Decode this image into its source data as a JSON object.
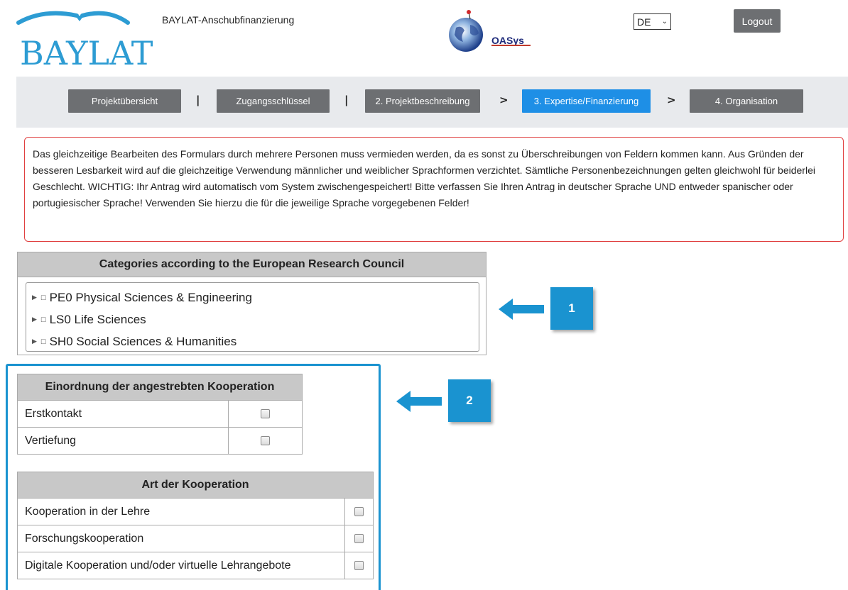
{
  "header": {
    "logo_text": "BAYLAT",
    "app_title": "BAYLAT-Anschubfinanzierung",
    "partner_logo_text": "OASys",
    "language": {
      "selected": "DE"
    },
    "logout_label": "Logout"
  },
  "nav": {
    "items": [
      {
        "label": "Projektübersicht",
        "active": false
      },
      {
        "label": "Zugangsschlüssel",
        "active": false
      },
      {
        "label": "2. Projektbeschreibung",
        "active": false
      },
      {
        "label": "3. Expertise/Finanzierung",
        "active": true
      },
      {
        "label": "4. Organisation",
        "active": false
      }
    ],
    "separators": [
      "|",
      "|",
      ">",
      ">"
    ]
  },
  "notice": {
    "text": "Das gleichzeitige Bearbeiten des Formulars durch mehrere Personen muss vermieden werden, da es sonst zu Überschreibungen von Feldern kommen kann. Aus Gründen der besseren Lesbarkeit wird auf die gleichzeitige Verwendung männlicher und weiblicher Sprachformen verzichtet. Sämtliche Personenbezeichnungen gelten gleichwohl für beiderlei Geschlecht. WICHTIG: Ihr Antrag wird automatisch vom System zwischengespeichert! Bitte verfassen Sie Ihren Antrag in deutscher Sprache UND entweder spanischer oder portugiesischer Sprache! Verwenden Sie hierzu die für die jeweilige Sprache vorgegebenen Felder!"
  },
  "erc": {
    "title": "Categories according to the European Research Council",
    "items": [
      {
        "label": "PE0 Physical Sciences & Engineering"
      },
      {
        "label": "LS0 Life Sciences"
      },
      {
        "label": "SH0 Social Sciences & Humanities"
      }
    ]
  },
  "cooperation_class": {
    "title": "Einordnung der angestrebten Kooperation",
    "rows": [
      {
        "label": "Erstkontakt",
        "checked": false
      },
      {
        "label": "Vertiefung",
        "checked": false
      }
    ]
  },
  "cooperation_type": {
    "title": "Art der Kooperation",
    "rows": [
      {
        "label": "Kooperation in der Lehre",
        "checked": false
      },
      {
        "label": "Forschungskooperation",
        "checked": false
      },
      {
        "label": "Digitale Kooperation und/oder virtuelle Lehrangebote",
        "checked": false
      }
    ]
  },
  "callouts": [
    {
      "label": "1"
    },
    {
      "label": "2"
    }
  ],
  "colors": {
    "brand_blue": "#2d9cd3",
    "nav_active": "#1e8fe6",
    "nav_inactive": "#6d6f72",
    "notice_border": "#e04040",
    "callout_blue": "#1a93d0"
  }
}
